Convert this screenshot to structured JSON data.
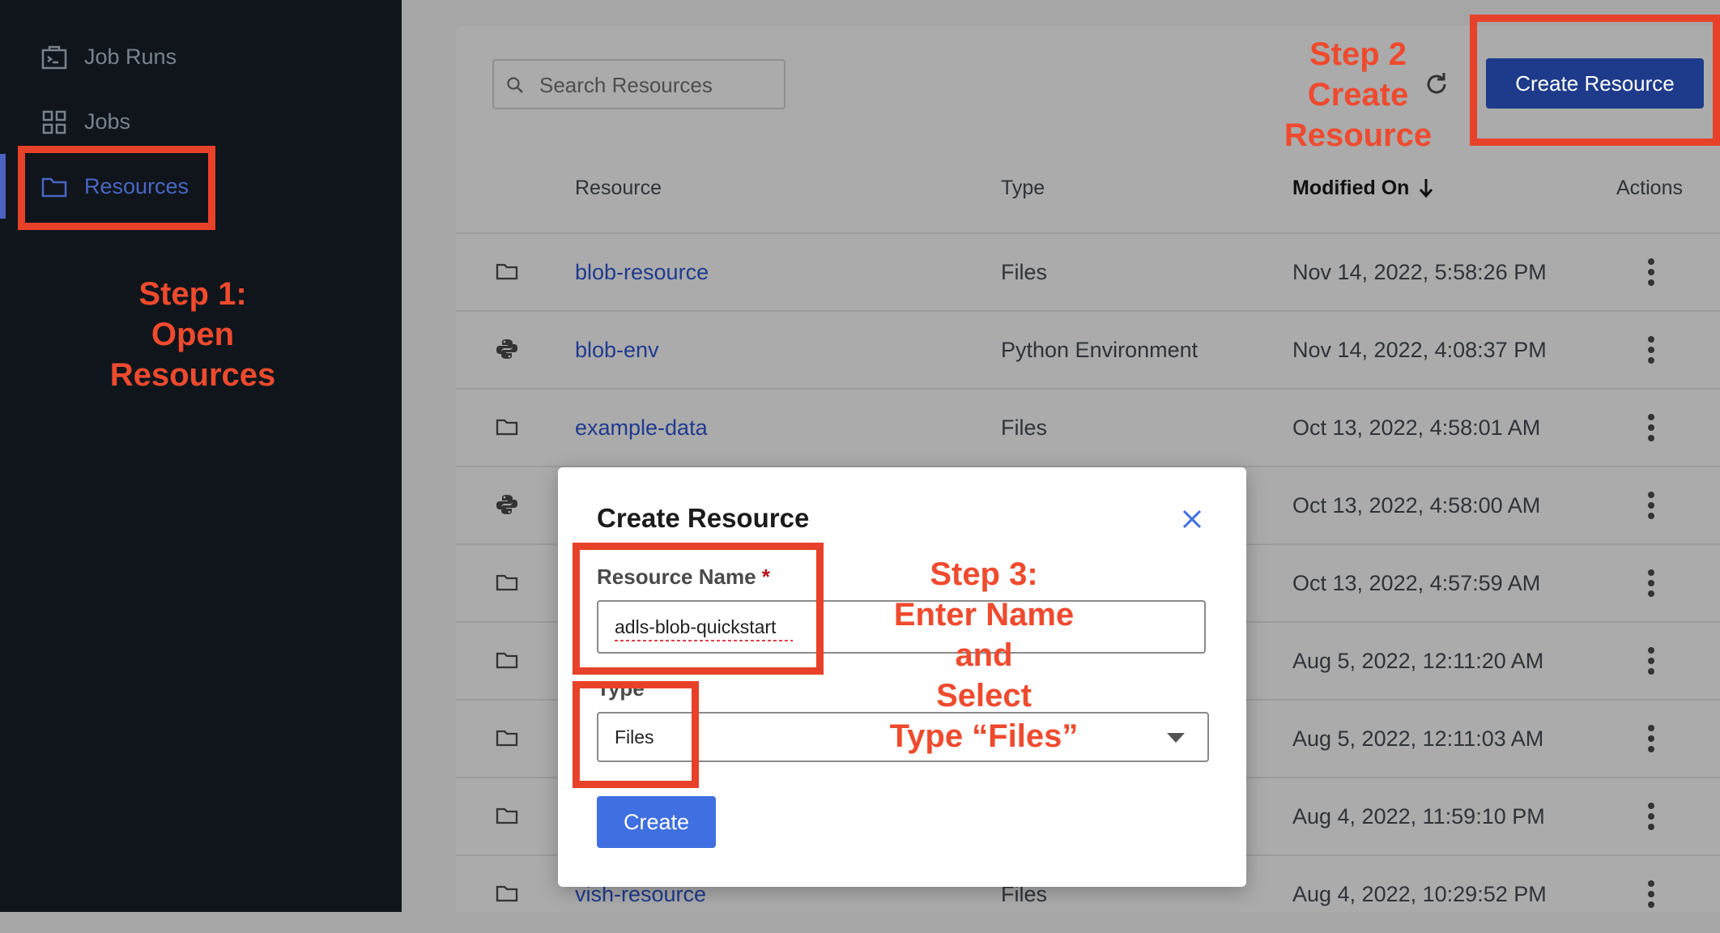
{
  "sidebar": {
    "items": [
      {
        "label": "Job Runs",
        "icon": "job-runs-icon"
      },
      {
        "label": "Jobs",
        "icon": "grid-icon"
      },
      {
        "label": "Resources",
        "icon": "folder-icon",
        "active": true
      }
    ]
  },
  "toolbar": {
    "search_placeholder": "Search Resources",
    "create_label": "Create Resource"
  },
  "table": {
    "columns": [
      "Resource",
      "Type",
      "Modified On",
      "Actions"
    ],
    "sort_column": "Modified On",
    "rows": [
      {
        "icon": "folder-icon",
        "name": "blob-resource",
        "type": "Files",
        "modified": "Nov 14, 2022, 5:58:26 PM"
      },
      {
        "icon": "python-icon",
        "name": "blob-env",
        "type": "Python Environment",
        "modified": "Nov 14, 2022, 4:08:37 PM"
      },
      {
        "icon": "folder-icon",
        "name": "example-data",
        "type": "Files",
        "modified": "Oct 13, 2022, 4:58:01 AM"
      },
      {
        "icon": "python-icon",
        "name": "",
        "type": "",
        "modified": "Oct 13, 2022, 4:58:00 AM"
      },
      {
        "icon": "folder-icon",
        "name": "",
        "type": "",
        "modified": "Oct 13, 2022, 4:57:59 AM"
      },
      {
        "icon": "folder-icon",
        "name": "",
        "type": "",
        "modified": "Aug 5, 2022, 12:11:20 AM"
      },
      {
        "icon": "folder-icon",
        "name": "",
        "type": "",
        "modified": "Aug 5, 2022, 12:11:03 AM"
      },
      {
        "icon": "folder-icon",
        "name": "",
        "type": "",
        "modified": "Aug 4, 2022, 11:59:10 PM"
      },
      {
        "icon": "folder-icon",
        "name": "vish-resource",
        "type": "Files",
        "modified": "Aug 4, 2022, 10:29:52 PM"
      }
    ]
  },
  "modal": {
    "title": "Create Resource",
    "name_label": "Resource Name",
    "required_mark": "*",
    "name_value": "adls-blob-quickstart",
    "type_label": "Type",
    "type_value": "Files",
    "create_label": "Create"
  },
  "annotations": {
    "step1": [
      "Step 1:",
      "Open",
      "Resources"
    ],
    "step2": [
      "Step 2",
      "Create",
      "Resource"
    ],
    "step3": [
      "Step 3:",
      "Enter Name",
      "and",
      "Select",
      "Type “Files”"
    ]
  },
  "colors": {
    "accent": "#1d3b8a",
    "link": "#1f3a8f",
    "annotation": "#e8412a",
    "sidebar_bg": "#0f151b"
  }
}
